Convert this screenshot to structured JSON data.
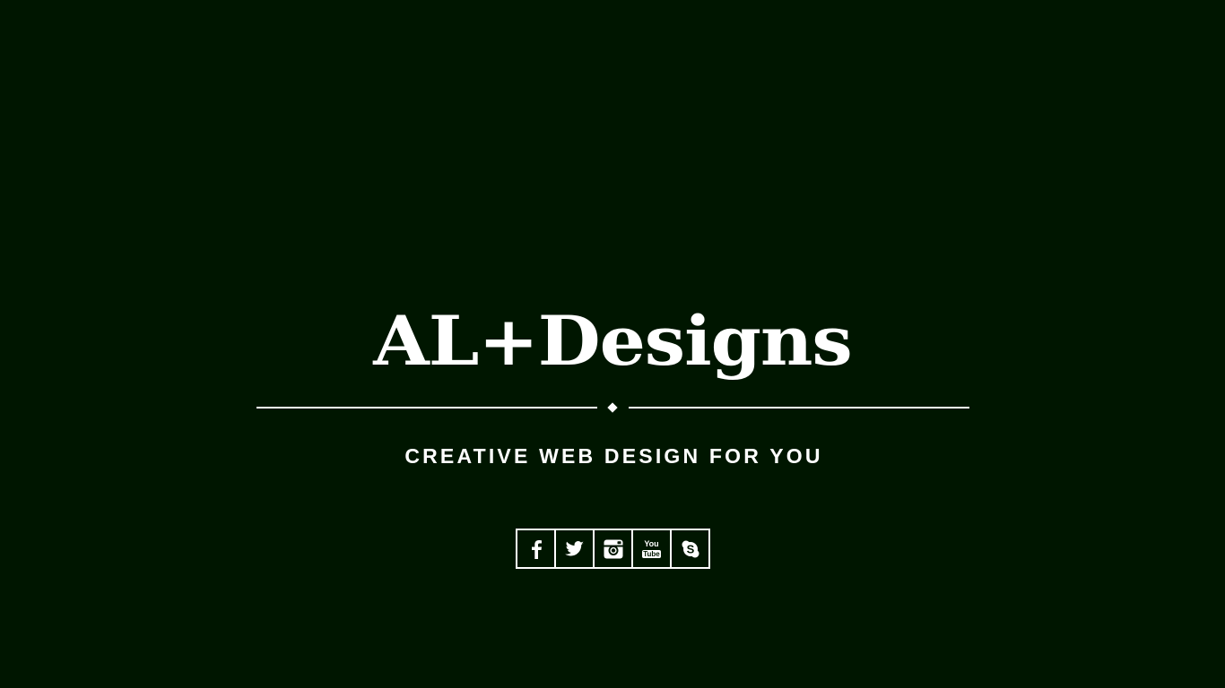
{
  "brand": {
    "logo_text": "AL+Designs",
    "tagline": "CREATIVE WEB DESIGN FOR YOU"
  },
  "social": {
    "items": [
      {
        "name": "Facebook",
        "icon": "facebook-icon",
        "glyph": "f"
      },
      {
        "name": "Twitter",
        "icon": "twitter-icon"
      },
      {
        "name": "Instagram",
        "icon": "instagram-icon"
      },
      {
        "name": "YouTube",
        "icon": "youtube-icon",
        "text_top": "You",
        "text_bottom": "Tube"
      },
      {
        "name": "Skype",
        "icon": "skype-icon",
        "glyph": "S"
      }
    ]
  },
  "colors": {
    "background": "#001600",
    "foreground": "#ffffff"
  }
}
